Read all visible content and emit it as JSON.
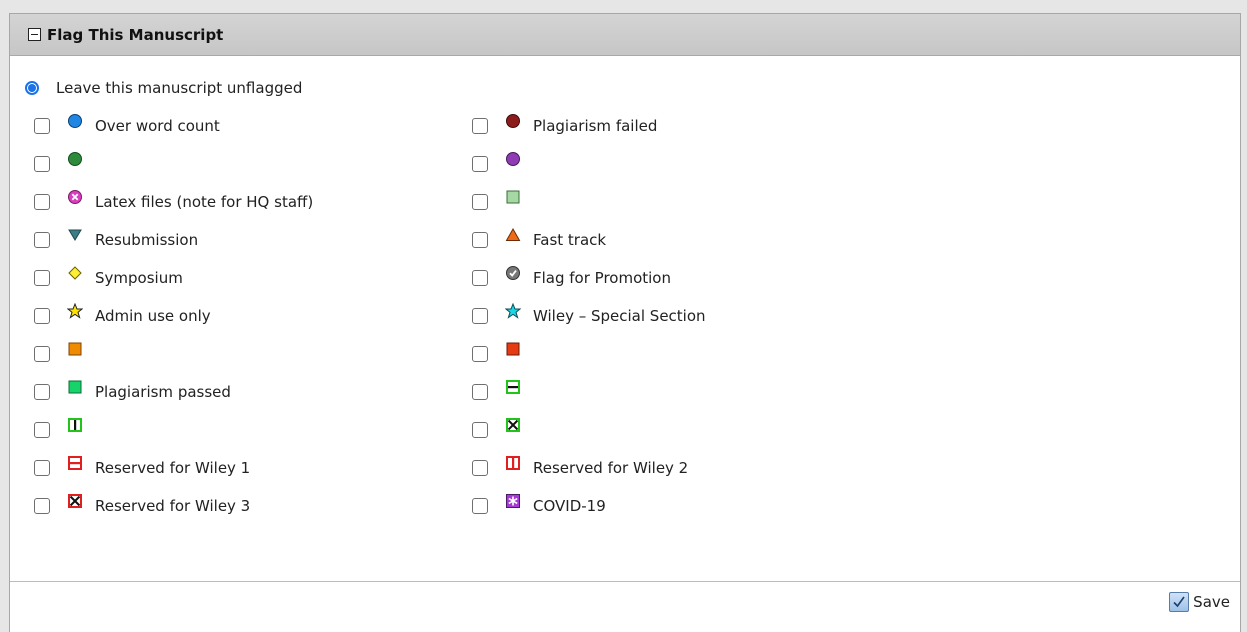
{
  "panel": {
    "title": "Flag This Manuscript"
  },
  "unflagged": {
    "label": "Leave this manuscript unflagged",
    "selected": true
  },
  "flags_left": [
    {
      "label": "Over word count",
      "icon": "blue-circle-icon"
    },
    {
      "label": "",
      "icon": "green-circle-icon"
    },
    {
      "label": "Latex files (note for HQ staff)",
      "icon": "pink-x-circle-icon"
    },
    {
      "label": "Resubmission",
      "icon": "teal-down-triangle-icon"
    },
    {
      "label": "Symposium",
      "icon": "yellow-diamond-icon"
    },
    {
      "label": "Admin use only",
      "icon": "yellow-star-icon"
    },
    {
      "label": "",
      "icon": "orange-square-icon"
    },
    {
      "label": "Plagiarism passed",
      "icon": "green-square-icon"
    },
    {
      "label": "",
      "icon": "green-vertical-bar-box-icon"
    },
    {
      "label": "Reserved for Wiley 1",
      "icon": "red-horizontal-bar-box-icon"
    },
    {
      "label": "Reserved for Wiley 3",
      "icon": "red-x-box-icon"
    }
  ],
  "flags_right": [
    {
      "label": "Plagiarism failed",
      "icon": "dark-red-circle-icon"
    },
    {
      "label": "",
      "icon": "purple-circle-icon"
    },
    {
      "label": "",
      "icon": "light-green-square-icon"
    },
    {
      "label": "Fast track",
      "icon": "orange-up-triangle-icon"
    },
    {
      "label": "Flag for Promotion",
      "icon": "gray-check-circle-icon"
    },
    {
      "label": "Wiley – Special Section",
      "icon": "cyan-star-icon"
    },
    {
      "label": "",
      "icon": "red-square-icon"
    },
    {
      "label": "",
      "icon": "green-horizontal-bar-box-icon"
    },
    {
      "label": "",
      "icon": "green-x-box-icon"
    },
    {
      "label": "Reserved for Wiley 2",
      "icon": "red-vertical-bar-box-icon"
    },
    {
      "label": "COVID-19",
      "icon": "purple-asterisk-box-icon"
    }
  ],
  "footer": {
    "save_label": "Save"
  },
  "colors": {
    "radio_blue": "#1a73e8",
    "header_gray": "#c9c9c9"
  }
}
